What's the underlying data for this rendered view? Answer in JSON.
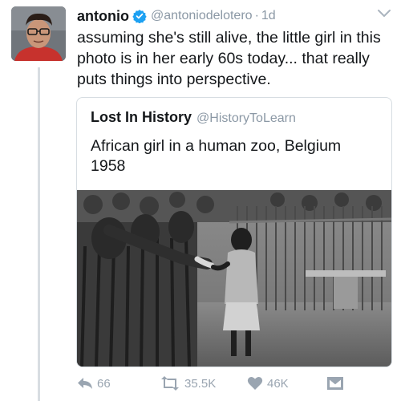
{
  "tweet": {
    "author_name": "antonio",
    "verified": true,
    "handle": "@antoniodelotero",
    "separator": "·",
    "time": "1d",
    "text": "assuming she's still alive, the little girl in this photo is in her early 60s today... that really puts things into perspective."
  },
  "quoted": {
    "author_name": "Lost In History",
    "handle": "@HistoryToLearn",
    "text": "African girl in a human zoo, Belgium 1958",
    "photo": "black-and-white photo"
  },
  "actions": {
    "reply_count": "66",
    "retweet_count": "35.5K",
    "like_count": "46K"
  },
  "colors": {
    "verified_blue": "#1da1f2",
    "secondary_text": "#8b98a5",
    "action_icon": "#9aa5b1",
    "border": "#d7dde2"
  },
  "icons": [
    "avatar-photo",
    "verified-badge-icon",
    "chevron-down-icon",
    "reply-icon",
    "retweet-icon",
    "heart-icon",
    "direct-message-icon"
  ]
}
